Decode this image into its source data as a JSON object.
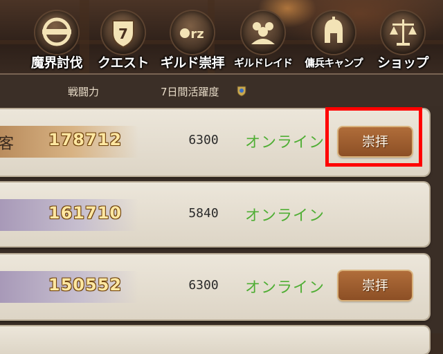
{
  "nav": {
    "items": [
      {
        "label": "魔界討伐",
        "icon": "emblem-o-icon"
      },
      {
        "label": "クエスト",
        "icon": "shield-seven-icon"
      },
      {
        "label": "ギルド崇拝",
        "icon": "orz-icon"
      },
      {
        "label": "ギルドレイド",
        "icon": "group-icon"
      },
      {
        "label": "傭兵キャンプ",
        "icon": "helmet-icon"
      },
      {
        "label": "ショップ",
        "icon": "scales-icon"
      }
    ]
  },
  "table": {
    "headers": {
      "power": "戦闘力",
      "activity": "7日間活躍度"
    },
    "rows": [
      {
        "name_fragment": "客",
        "power": "178712",
        "activity": "6300",
        "status": "オンライン",
        "button": "崇拝",
        "bar": "gold"
      },
      {
        "name_fragment": "",
        "power": "161710",
        "activity": "5840",
        "status": "オンライン",
        "button": "",
        "bar": "purple"
      },
      {
        "name_fragment": "",
        "power": "150552",
        "activity": "6300",
        "status": "オンライン",
        "button": "崇拝",
        "bar": "purple"
      }
    ]
  },
  "colors": {
    "highlight": "#ff0000",
    "status_online": "#4fae34",
    "power_text": "#ffe7a1"
  }
}
